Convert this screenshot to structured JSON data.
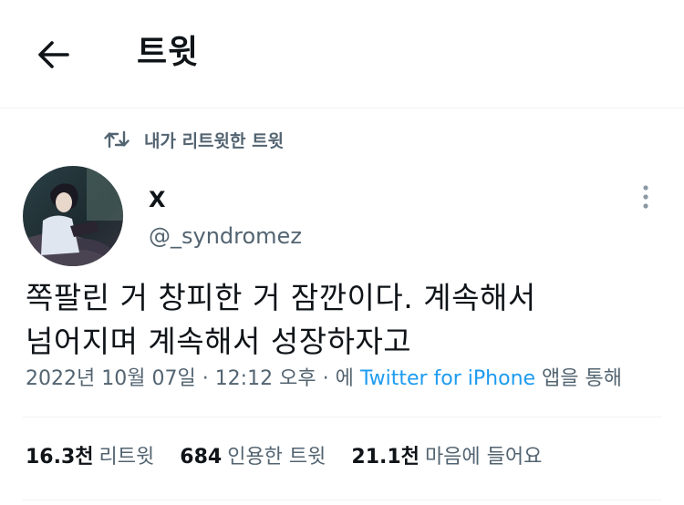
{
  "header": {
    "title": "트윗",
    "back_icon": "arrow-left-icon"
  },
  "retweet_context": {
    "icon": "retweet-icon",
    "label": "내가 리트윗한 트윗"
  },
  "author": {
    "name": "X",
    "handle": "@_syndromez"
  },
  "tweet": {
    "lines": [
      "쪽팔린 거 창피한 거 잠깐이다. 계속해서",
      "넘어지며 계속해서 성장하자고"
    ]
  },
  "meta": {
    "date": "2022년 10월 07일",
    "sep1": "·",
    "time": "12:12 오후",
    "sep2": "·",
    "via_prefix": "에",
    "client": "Twitter for iPhone",
    "via_suffix": "앱을 통해"
  },
  "stats": {
    "retweets_count": "16.3천",
    "retweets_label": "리트윗",
    "quotes_count": "684",
    "quotes_label": "인용한 트윗",
    "likes_count": "21.1천",
    "likes_label": "마음에 들어요"
  },
  "colors": {
    "text": "#0f1419",
    "secondary": "#536471",
    "link": "#1d9bf0",
    "divider": "#eff3f4"
  }
}
